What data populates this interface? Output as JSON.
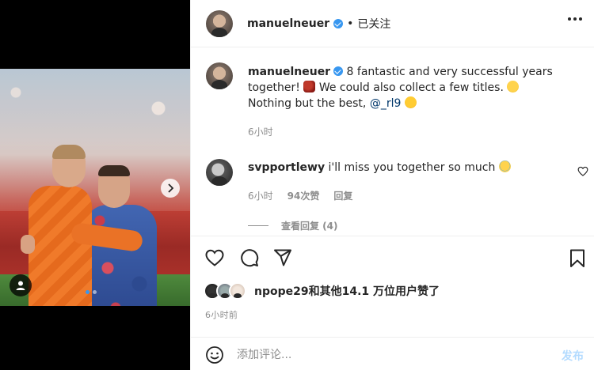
{
  "post": {
    "username": "manuelneuer",
    "follow_status": "已关注",
    "caption_text": "8 fantastic and very successful years together!",
    "caption_text_2": "We could also collect a few titles.",
    "caption_text_3": "Nothing but the best,",
    "mention": "@_rl9",
    "caption_time": "6小时",
    "emoji": [
      "hearts-emoji",
      "smile-emoji",
      "hug-emoji"
    ]
  },
  "comment": {
    "username": "svpportlewy",
    "text": "i'll miss you together so much",
    "time": "6小时",
    "likes": "94次赞",
    "reply_label": "回复",
    "view_replies": "查看回复 (4)"
  },
  "likes": {
    "text_user": "npope29",
    "text_rest": "和其他14.1 万位用户赞了"
  },
  "post_time": "6小时前",
  "composer": {
    "placeholder": "添加评论...",
    "post_label": "发布"
  },
  "colors": {
    "accent": "#3897f0",
    "mention": "#00376b",
    "muted": "#8e8e8e",
    "post_disabled": "#b3dbff"
  }
}
